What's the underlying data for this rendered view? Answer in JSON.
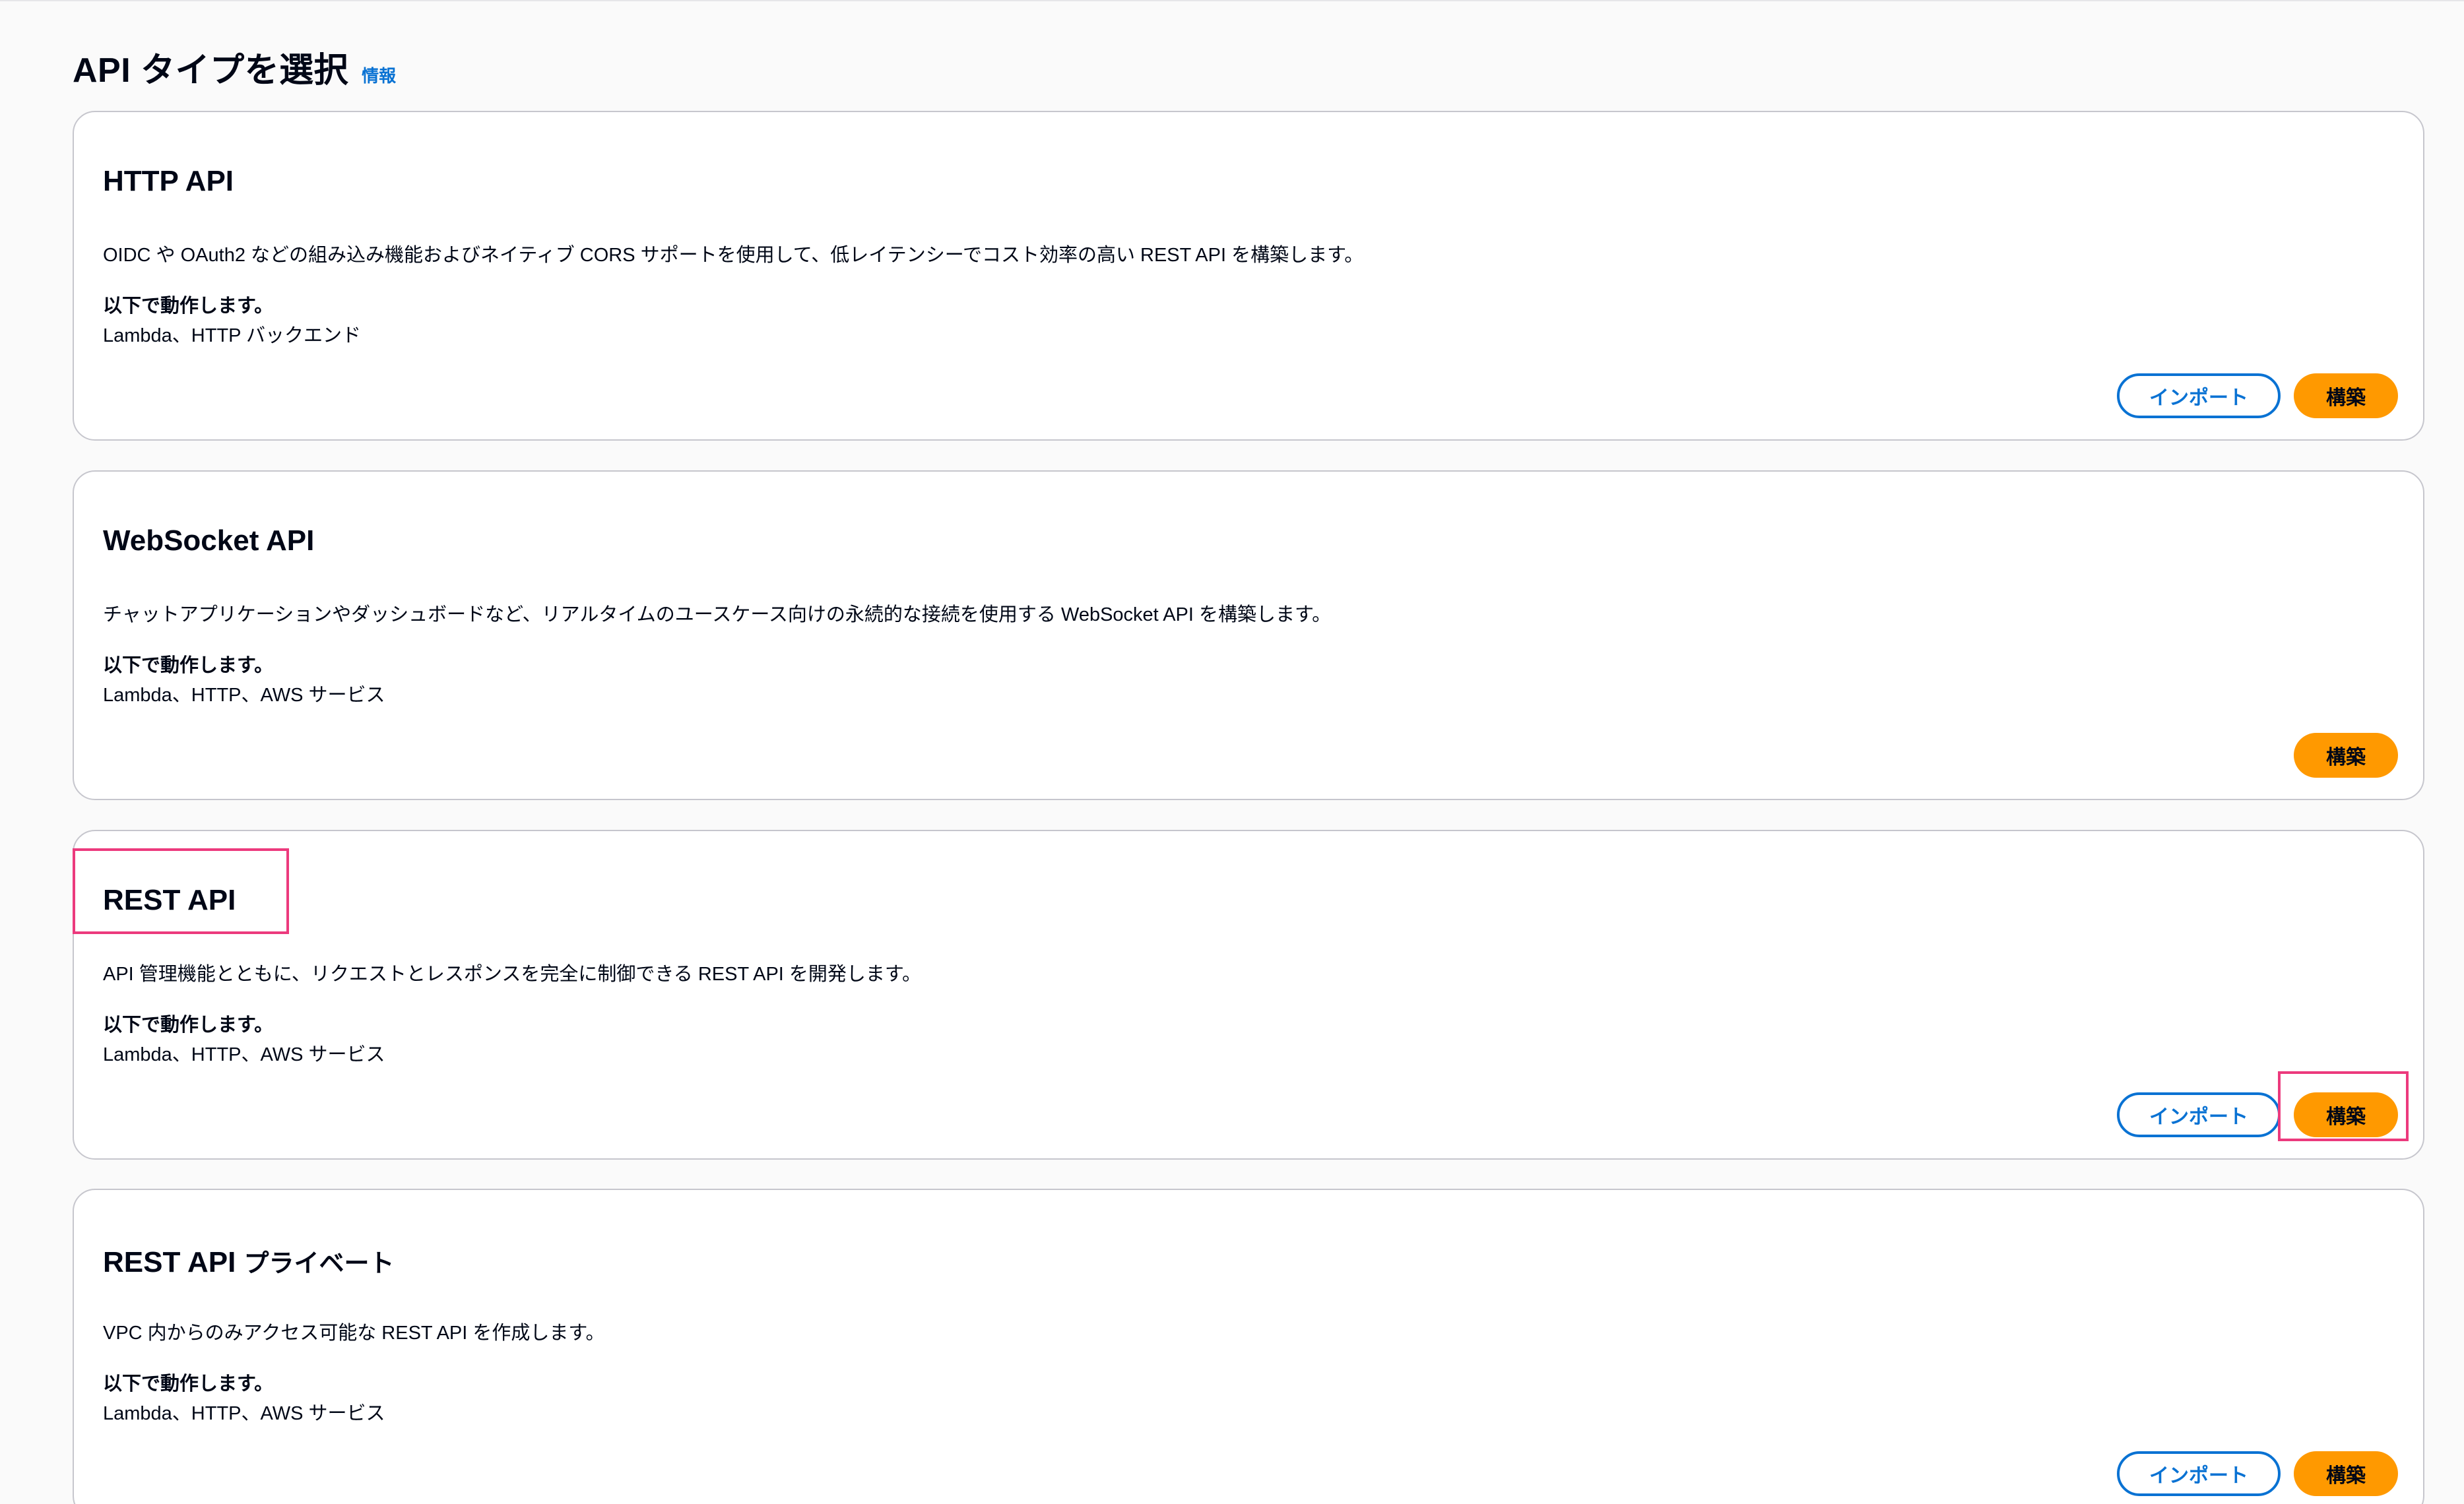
{
  "header": {
    "title": "API タイプを選択",
    "info_link": "情報"
  },
  "cards": [
    {
      "title": "HTTP API",
      "title_suffix": "",
      "description": "OIDC や OAuth2 などの組み込み機能およびネイティブ CORS サポートを使用して、低レイテンシーでコスト効率の高い REST API を構築します。",
      "works_with_label": "以下で動作します。",
      "works_with_value": "Lambda、HTTP バックエンド",
      "import_label": "インポート",
      "build_label": "構築"
    },
    {
      "title": "WebSocket API",
      "title_suffix": "",
      "description": "チャットアプリケーションやダッシュボードなど、リアルタイムのユースケース向けの永続的な接続を使用する WebSocket API を構築します。",
      "works_with_label": "以下で動作します。",
      "works_with_value": "Lambda、HTTP、AWS サービス",
      "build_label": "構築"
    },
    {
      "title": "REST API",
      "title_suffix": "",
      "description": "API 管理機能とともに、リクエストとレスポンスを完全に制御できる REST API を開発します。",
      "works_with_label": "以下で動作します。",
      "works_with_value": "Lambda、HTTP、AWS サービス",
      "import_label": "インポート",
      "build_label": "構築"
    },
    {
      "title": "REST API",
      "title_suffix": "プライベート",
      "description": "VPC 内からのみアクセス可能な REST API を作成します。",
      "works_with_label": "以下で動作します。",
      "works_with_value": "Lambda、HTTP、AWS サービス",
      "import_label": "インポート",
      "build_label": "構築"
    }
  ],
  "colors": {
    "primary_button": "#ff9900",
    "link_blue": "#0972d3",
    "highlight_pink": "#ec3a7d",
    "card_border": "#c6c6cd"
  }
}
